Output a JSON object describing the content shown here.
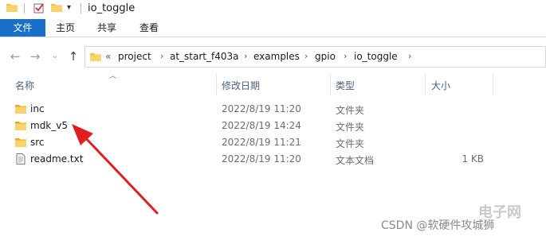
{
  "window": {
    "title": "io_toggle"
  },
  "ribbon": {
    "tabs": [
      "文件",
      "主页",
      "共享",
      "查看"
    ]
  },
  "address_bar": {
    "overflow": "«",
    "crumbs": [
      "project",
      "at_start_f403a",
      "examples",
      "gpio",
      "io_toggle"
    ]
  },
  "columns": {
    "name": "名称",
    "date": "修改日期",
    "type": "类型",
    "size": "大小"
  },
  "files": [
    {
      "name": "inc",
      "date": "2022/8/19 11:20",
      "type": "文件夹",
      "size": "",
      "kind": "folder"
    },
    {
      "name": "mdk_v5",
      "date": "2022/8/19 14:24",
      "type": "文件夹",
      "size": "",
      "kind": "folder"
    },
    {
      "name": "src",
      "date": "2022/8/19 11:21",
      "type": "文件夹",
      "size": "",
      "kind": "folder"
    },
    {
      "name": "readme.txt",
      "date": "2022/8/19 11:20",
      "type": "文本文档",
      "size": "1 KB",
      "kind": "text"
    }
  ],
  "icons": {
    "folder": "folder-icon",
    "check": "checkmark-icon",
    "back": "back-arrow-icon",
    "forward": "forward-arrow-icon",
    "recent": "chevron-down-icon",
    "up": "up-arrow-icon",
    "text_file": "text-file-icon"
  },
  "colors": {
    "file_tab": "#1a6fc9",
    "folder": "#f5c142",
    "annotation_arrow": "#e02020"
  },
  "watermark": {
    "text": "CSDN @软硬件攻城狮",
    "logo": "电子网"
  }
}
